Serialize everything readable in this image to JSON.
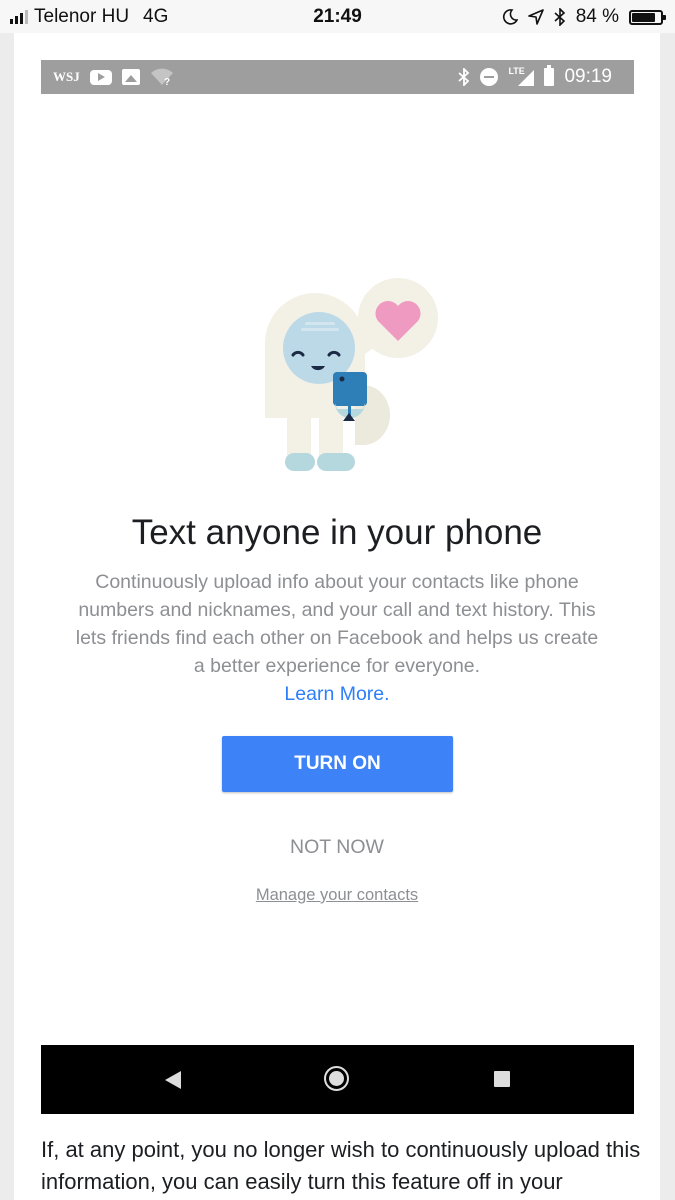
{
  "ios_status": {
    "carrier": "Telenor HU",
    "network": "4G",
    "time": "21:49",
    "battery": "84 %",
    "battery_level": 0.84,
    "icons": [
      "signal-icon",
      "moon-icon",
      "location-icon",
      "bluetooth-icon",
      "battery-icon"
    ]
  },
  "android_status": {
    "app_label": "WSJ",
    "time": "09:19",
    "lte": "LTE",
    "icons": [
      "youtube-icon",
      "image-icon",
      "wifi-question-icon",
      "bluetooth-icon",
      "do-not-disturb-icon",
      "lte-signal-icon",
      "battery-icon"
    ]
  },
  "dialog": {
    "headline": "Text anyone in your phone",
    "body": "Continuously upload info about your contacts like phone numbers and nicknames, and your call and text history. This lets friends find each other on Facebook and helps us create a better experience for everyone.",
    "learn_more": "Learn More",
    "learn_more_suffix": ".",
    "turn_on": "TURN ON",
    "not_now": "NOT NOW",
    "manage": "Manage your contacts"
  },
  "android_nav": {
    "icons": [
      "back-icon",
      "home-icon",
      "recents-icon"
    ]
  },
  "article": {
    "paragraph": "If, at any point, you no longer wish to continuously upload this information, you can easily turn this feature off in your"
  },
  "colors": {
    "primary_button": "#3d82f6",
    "link": "#2d7ff9",
    "heart": "#ef9ac0",
    "phone": "#2e7fb8"
  }
}
